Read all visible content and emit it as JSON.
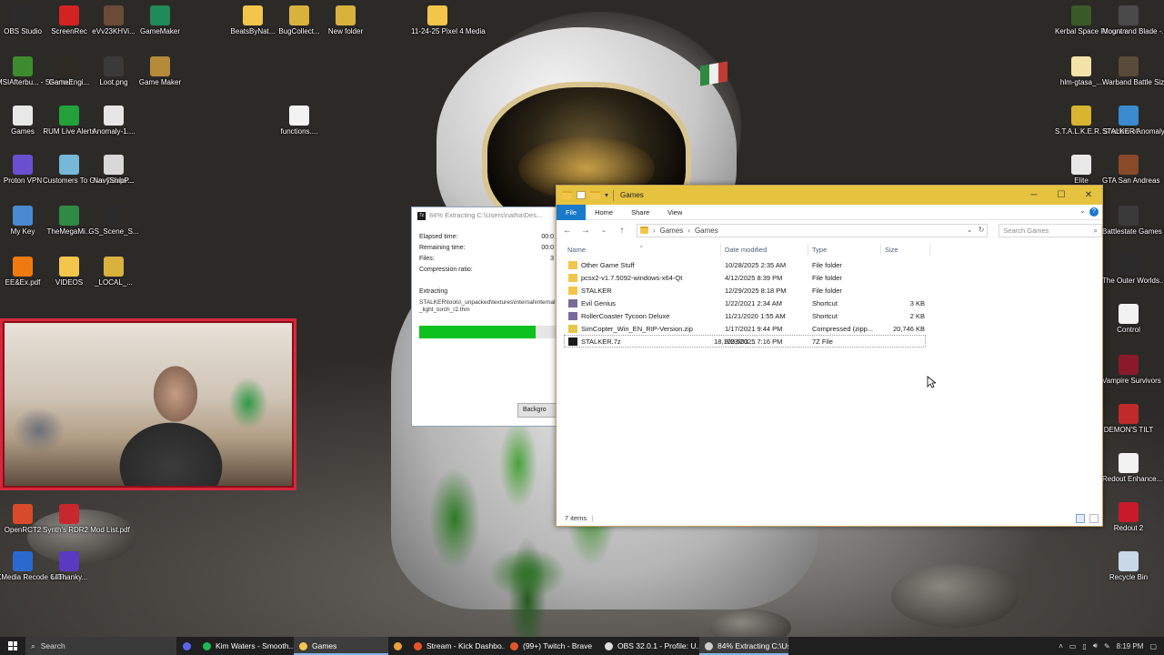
{
  "desktop_left": [
    {
      "label": "OBS Studio",
      "icon": "obs-icon",
      "color": "#2b2b2b"
    },
    {
      "label": "ScreenRec",
      "icon": "screenrec-icon",
      "color": "#d32222"
    },
    {
      "label": "eVv23KHVi...",
      "icon": "video-file-icon",
      "color": "#6b4a36"
    },
    {
      "label": "GameMaker",
      "icon": "gamemaker-icon",
      "color": "#1f8a5a"
    },
    {
      "label": "MSIAfterbu... - Shortcut",
      "icon": "msi-afterburner-icon",
      "color": "#3c8c2d"
    },
    {
      "label": "GameEngi...",
      "icon": "image-file-icon",
      "color": "#2d2a22"
    },
    {
      "label": "Loot.png",
      "icon": "image-file-icon",
      "color": "#3a3a3a"
    },
    {
      "label": "Game Maker",
      "icon": "game-maker-icon",
      "color": "#b58b3a"
    },
    {
      "label": "Games",
      "icon": "games-shortcut-icon",
      "color": "#e8e8e8"
    },
    {
      "label": "RUM Live Alerts",
      "icon": "rum-icon",
      "color": "#23a23a"
    },
    {
      "label": "Anomaly-1....",
      "icon": "7z-archive-icon",
      "color": "#e6e6e6"
    },
    {
      "label": "Proton VPN",
      "icon": "proton-vpn-icon",
      "color": "#6a4fd1"
    },
    {
      "label": "Customers To Give Dealer...",
      "icon": "app-icon",
      "color": "#76b8d8"
    },
    {
      "label": "NavyShipP...",
      "icon": "file-icon",
      "color": "#d8d8d8"
    },
    {
      "label": "My Key",
      "icon": "key-icon",
      "color": "#4a8ad0"
    },
    {
      "label": "TheMegaMi...",
      "icon": "mega-icon",
      "color": "#2f8a44"
    },
    {
      "label": "GS_Scene_S...",
      "icon": "image-file-icon",
      "color": "#2a2a2a"
    },
    {
      "label": "EE&Ex.pdf",
      "icon": "vlc-icon",
      "color": "#f07a10"
    },
    {
      "label": "VIDEOS",
      "icon": "folder-icon",
      "color": "#f3c64b"
    },
    {
      "label": "_LOCAL_...",
      "icon": "archive-icon",
      "color": "#d9b23e"
    },
    {
      "label": "OpenRCT2",
      "icon": "openrct2-icon",
      "color": "#d84a2a"
    },
    {
      "label": "Synth's RDR2 Mod List.pdf",
      "icon": "pdf-icon",
      "color": "#c7282d"
    },
    {
      "label": "XMedia Recode 64bit",
      "icon": "xmedia-icon",
      "color": "#2a6ad0"
    },
    {
      "label": "LilThanky...",
      "icon": "app-icon",
      "color": "#5a3ac0"
    }
  ],
  "desktop_middle": [
    {
      "label": "BeatsByNat...",
      "icon": "folder-icon",
      "color": "#f3c64b"
    },
    {
      "label": "BugCollect...",
      "icon": "archive-icon",
      "color": "#d9b23e"
    },
    {
      "label": "New folder",
      "icon": "archive-icon",
      "color": "#d9b23e"
    },
    {
      "label": "11-24-25 Pixel 4 Media",
      "icon": "folder-icon",
      "color": "#f3c64b"
    },
    {
      "label": "functions....",
      "icon": "file-icon",
      "color": "#f2f2f2"
    }
  ],
  "desktop_right": [
    {
      "label": "Kerbal Space Program",
      "icon": "kerbal-icon",
      "color": "#3a5a2a"
    },
    {
      "label": "Mount and Blade -...",
      "icon": "mount-blade-icon",
      "color": "#4a4a4a"
    },
    {
      "label": "hlm-gtasa_...",
      "icon": "file-icon",
      "color": "#f3e3a8"
    },
    {
      "label": "Warband Battle Sizer",
      "icon": "warband-icon",
      "color": "#5a4a3a"
    },
    {
      "label": "S.T.A.L.K.E.R. Shadow of...",
      "icon": "stalker-icon",
      "color": "#d8b430"
    },
    {
      "label": "STALKER Anomaly",
      "icon": "anomaly-icon",
      "color": "#3a8ad0"
    },
    {
      "label": "Elite",
      "icon": "elite-icon",
      "color": "#e8e8e8"
    },
    {
      "label": "GTA San Andreas",
      "icon": "gta-icon",
      "color": "#8a4a2a"
    },
    {
      "label": "Battlestate Games L...",
      "icon": "battlestate-icon",
      "color": "#3a3a3a"
    },
    {
      "label": "The Outer Worlds...",
      "icon": "outer-worlds-icon",
      "color": "#2a2a2a"
    },
    {
      "label": "Control",
      "icon": "control-icon",
      "color": "#f2f2f2"
    },
    {
      "label": "Vampire Survivors",
      "icon": "vampire-survivors-icon",
      "color": "#8a1a2a"
    },
    {
      "label": "DEMON'S TILT",
      "icon": "demons-tilt-icon",
      "color": "#c02a2a"
    },
    {
      "label": "Redout Enhance...",
      "icon": "redout-icon",
      "color": "#f2f2f2"
    },
    {
      "label": "Redout 2",
      "icon": "redout2-icon",
      "color": "#c81a2a"
    },
    {
      "label": "Recycle Bin",
      "icon": "recycle-bin-icon",
      "color": "#c8d8e8"
    }
  ],
  "zip_dialog": {
    "title": "84% Extracting C:\\Users\\natha\\Des...",
    "logo": "7z",
    "elapsed_label": "Elapsed time:",
    "elapsed_value": "00:0",
    "remaining_label": "Remaining time:",
    "remaining_value": "00:0",
    "files_label": "Files:",
    "files_value": "3",
    "ratio_label": "Compression ratio:",
    "extracting_label": "Extracting",
    "current_file": "STALKER\\tools\\_unpacked\\textures\\internal\\internal_light_torch_r2.thm",
    "progress": 0.84,
    "background_button": "Backgro"
  },
  "explorer": {
    "title": "Games",
    "ribbon_tabs": [
      "File",
      "Home",
      "Share",
      "View"
    ],
    "breadcrumb": [
      "Games",
      "Games"
    ],
    "search_placeholder": "Search Games",
    "columns": {
      "name": "Name",
      "date": "Date modified",
      "type": "Type",
      "size": "Size"
    },
    "files": [
      {
        "name": "Other Game Stuff",
        "date": "10/28/2025 2:35 AM",
        "type": "File folder",
        "size": "",
        "icon": "folder-icon"
      },
      {
        "name": "pcsx2-v1.7.5092-windows-x64-Qt",
        "date": "4/12/2025 8:39 PM",
        "type": "File folder",
        "size": "",
        "icon": "folder-icon"
      },
      {
        "name": "STALKER",
        "date": "12/29/2025 8:18 PM",
        "type": "File folder",
        "size": "",
        "icon": "folder-icon"
      },
      {
        "name": "Evil Genius",
        "date": "1/22/2021 2:34 AM",
        "type": "Shortcut",
        "size": "3 KB",
        "icon": "shortcut-icon"
      },
      {
        "name": "RollerCoaster Tycoon Deluxe",
        "date": "11/21/2020 1:55 AM",
        "type": "Shortcut",
        "size": "2 KB",
        "icon": "shortcut-icon"
      },
      {
        "name": "SimCopter_Win_EN_RIP-Version.zip",
        "date": "1/17/2021 9:44 PM",
        "type": "Compressed (zipp...",
        "size": "20,746 KB",
        "icon": "zip-icon"
      },
      {
        "name": "STALKER.7z",
        "date": "8/23/2025 7:16 PM",
        "type": "7Z File",
        "size": "18,109,503 ...",
        "icon": "7z-icon"
      }
    ],
    "status": "7 items"
  },
  "taskbar": {
    "search_placeholder": "Search",
    "items": [
      {
        "label": "Kim Waters - Smooth...",
        "icon": "spotify-icon",
        "color": "#1db954",
        "active": false
      },
      {
        "label": "Games",
        "icon": "folder-icon",
        "color": "#f3c64b",
        "active": true
      },
      {
        "label": "",
        "icon": "chrome-icon",
        "color": "#e8a13a",
        "active": false
      },
      {
        "label": "Stream - Kick Dashbo...",
        "icon": "brave-icon",
        "color": "#e8542a",
        "active": false
      },
      {
        "label": "(99+) Twitch - Brave",
        "icon": "brave-icon",
        "color": "#e8542a",
        "active": false
      },
      {
        "label": "OBS 32.0.1 - Profile: U...",
        "icon": "obs-icon",
        "color": "#dddddd",
        "active": false
      },
      {
        "label": "84% Extracting C:\\Us...",
        "icon": "7z-icon",
        "color": "#cccccc",
        "active": true
      }
    ],
    "time": "8:19 PM"
  },
  "colors": {
    "explorer_title_bar": "#e6c33f",
    "ribbon_file_tab": "#1979ca",
    "progress_fill": "#0dc21f",
    "webcam_border": "#d6283a",
    "taskbar_bg": "#1f1f1f"
  }
}
